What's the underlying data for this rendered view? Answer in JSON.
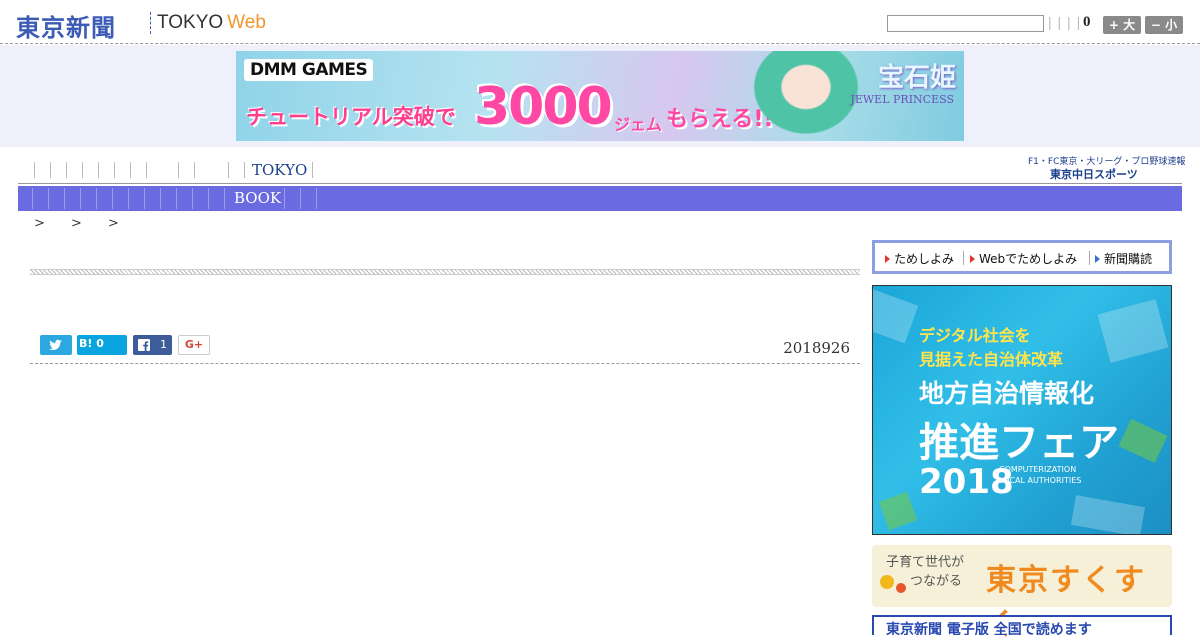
{
  "header": {
    "logo_jp": "東京新聞",
    "logo_en": "TOKYO",
    "logo_web": "Web",
    "search_placeholder": "",
    "pipes": "| | | |",
    "count": "0",
    "font_larger": "+ 大",
    "font_smaller": "− 小"
  },
  "banner": {
    "brand": "DMM GAMES",
    "text_left": "チュートリアル突破で",
    "number": "3000",
    "unit": "ジェム",
    "suffix": "もらえる!!",
    "title": "宝石姫",
    "subtitle": "JEWEL PRINCESS"
  },
  "nav": {
    "top_label": "TOKYO",
    "sub_label": "BOOK",
    "chunichi_line1": "F1・FC東京・大リーグ・プロ野球速報",
    "chunichi_line2": "東京中日スポーツ"
  },
  "breadcrumb": "> > >",
  "article": {
    "date": "2018926",
    "hatena_label": "B! 0",
    "facebook_count": "1",
    "gplus_label": "G+"
  },
  "sidebar": {
    "tabs": [
      "ためしよみ",
      "Webでためしよみ",
      "新聞購読"
    ],
    "ad": {
      "line1": "デジタル社会を",
      "line2": "見据えた自治体改革",
      "line3": "地方自治情報化",
      "line4": "推進フェア",
      "year": "2018",
      "en": "COMPUTERIZATION LOCAL AUTHORITIES"
    },
    "suku": {
      "small_line1": "子育て世代が",
      "small_line2": "つながる",
      "big": "東京すくすく"
    },
    "shimbun": "東京新聞 電子版 全国で読めます"
  },
  "colors": {
    "brand_blue": "#3b5bb5",
    "nav_purple": "#6b6be1",
    "web_orange": "#f0962a",
    "ad_blue": "#1aa6d8"
  }
}
